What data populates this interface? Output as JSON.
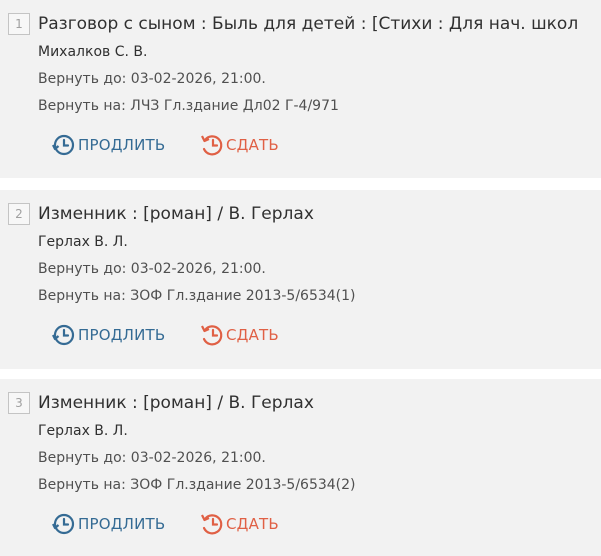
{
  "colors": {
    "renew": "#356b94",
    "return": "#e06045",
    "card_bg": "#f2f2f2"
  },
  "icons": {
    "renew": "clock-forward-icon",
    "return": "history-back-icon"
  },
  "loans": [
    {
      "number": "1",
      "title": "Разговор с сыном : Быль для детей : [Стихи : Для нач. школ",
      "author": "Михалков С. В.",
      "due": "Вернуть до: 03-02-2026, 21:00.",
      "return_place": "Вернуть на: ЛЧЗ Гл.здание Дл02 Г-4/971",
      "renew_label": "ПРОДЛИТЬ",
      "return_label": "СДАТЬ"
    },
    {
      "number": "2",
      "title": "Изменник : [роман] / В. Герлах",
      "author": "Герлах В. Л.",
      "due": "Вернуть до: 03-02-2026, 21:00.",
      "return_place": "Вернуть на: ЗОФ Гл.здание 2013-5/6534(1)",
      "renew_label": "ПРОДЛИТЬ",
      "return_label": "СДАТЬ"
    },
    {
      "number": "3",
      "title": "Изменник : [роман] / В. Герлах",
      "author": "Герлах В. Л.",
      "due": "Вернуть до: 03-02-2026, 21:00.",
      "return_place": "Вернуть на: ЗОФ Гл.здание 2013-5/6534(2)",
      "renew_label": "ПРОДЛИТЬ",
      "return_label": "СДАТЬ"
    }
  ]
}
